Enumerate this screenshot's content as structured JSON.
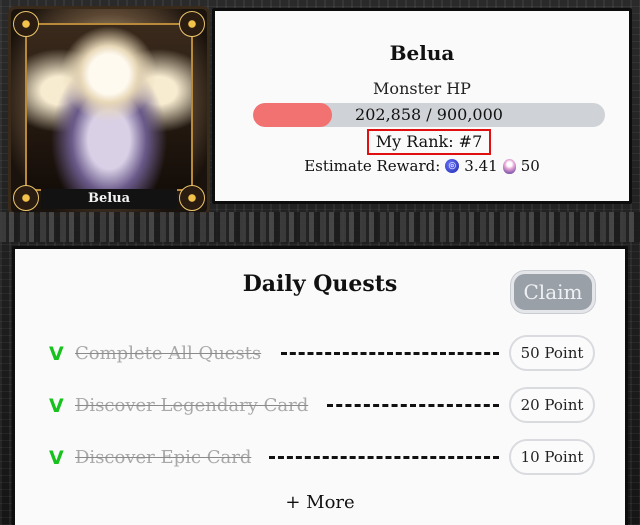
{
  "boss": {
    "name": "Belua",
    "portrait_label": "Belua",
    "hp_label": "Monster HP",
    "hp_current": "202,858",
    "hp_max": "900,000",
    "hp_text": "202,858 / 900,000",
    "hp_fraction": 0.225,
    "rank_text": "My Rank: #7",
    "reward_label": "Estimate Reward:",
    "reward_token_amount": "3.41",
    "reward_gem_amount": "50",
    "colors": {
      "hp_fill": "#f27272",
      "hp_track": "#cfd2d6",
      "rank_border": "#e01010"
    }
  },
  "quests": {
    "title": "Daily Quests",
    "claim_label": "Claim",
    "check_mark": "V",
    "items": [
      {
        "label": "Complete All Quests",
        "points": "50 Point",
        "completed": true
      },
      {
        "label": "Discover Legendary Card",
        "points": "20 Point",
        "completed": true
      },
      {
        "label": "Discover Epic Card",
        "points": "10 Point",
        "completed": true
      }
    ],
    "more_label": "+ More",
    "colors": {
      "check": "#16c21b",
      "claim_bg": "#9aa0a8"
    }
  },
  "icons": [
    "token-icon",
    "gem-icon"
  ]
}
